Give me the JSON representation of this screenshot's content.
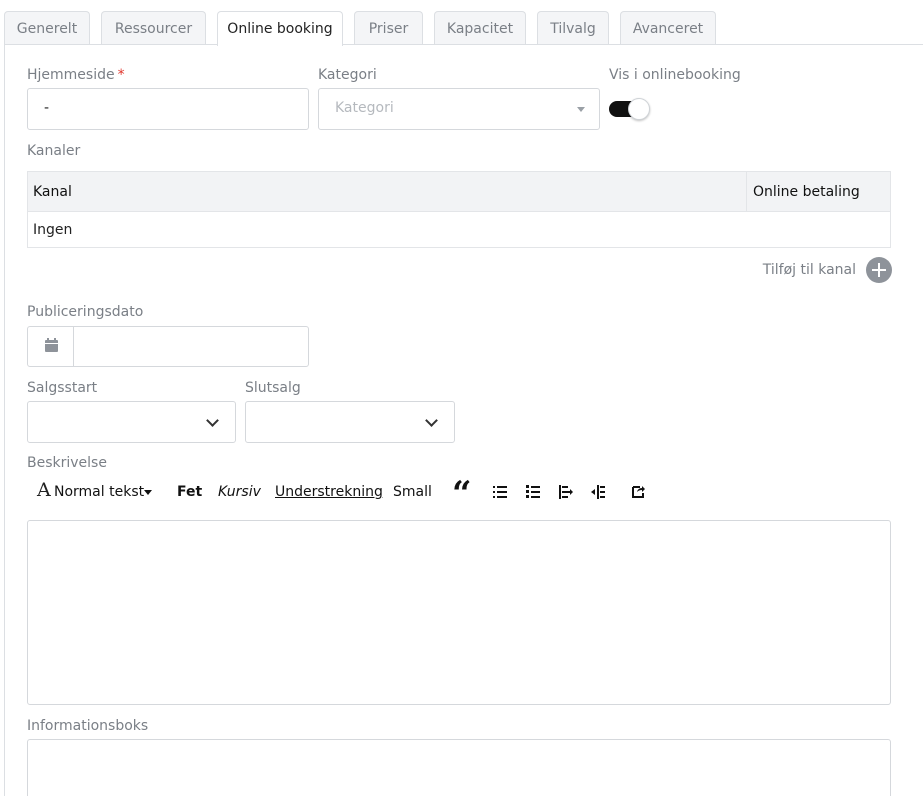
{
  "tabs": [
    {
      "label": "Generelt",
      "active": false
    },
    {
      "label": "Ressourcer",
      "active": false
    },
    {
      "label": "Online booking",
      "active": true
    },
    {
      "label": "Priser",
      "active": false
    },
    {
      "label": "Kapacitet",
      "active": false
    },
    {
      "label": "Tilvalg",
      "active": false
    },
    {
      "label": "Avanceret",
      "active": false
    }
  ],
  "form": {
    "website_label": "Hjemmeside",
    "required_mark": "*",
    "website_value": "-",
    "category_label": "Kategori",
    "category_placeholder": "Kategori",
    "show_online_label": "Vis i onlinebooking",
    "show_online_enabled": true,
    "channels_label": "Kanaler",
    "channels_table": {
      "columns": [
        "Kanal",
        "Online betaling"
      ],
      "empty_text": "Ingen"
    },
    "add_channel_label": "Tilføj til kanal",
    "publish_date_label": "Publiceringsdato",
    "publish_date_value": "",
    "sales_start_label": "Salgsstart",
    "sales_end_label": "Slutsalg",
    "description_label": "Beskrivelse",
    "infobox_label": "Informationsboks"
  },
  "toolbar": {
    "format_icon": "A",
    "format_label": "Normal tekst",
    "bold": "Fet",
    "italic": "Kursiv",
    "underline": "Understrekning",
    "small": "Small",
    "quote": "“"
  },
  "icons": {
    "toolbar": [
      "format-icon",
      "quote-icon",
      "bullet-list-icon",
      "numbered-list-icon",
      "indent-icon",
      "outdent-icon",
      "redo-icon"
    ],
    "add": "plus-circle-icon",
    "calendar": "calendar-icon",
    "select": "chevron-down-icon"
  },
  "colors": {
    "toggle_on": "#111111",
    "required": "#e0342b",
    "muted_text": "#7a7f86"
  }
}
